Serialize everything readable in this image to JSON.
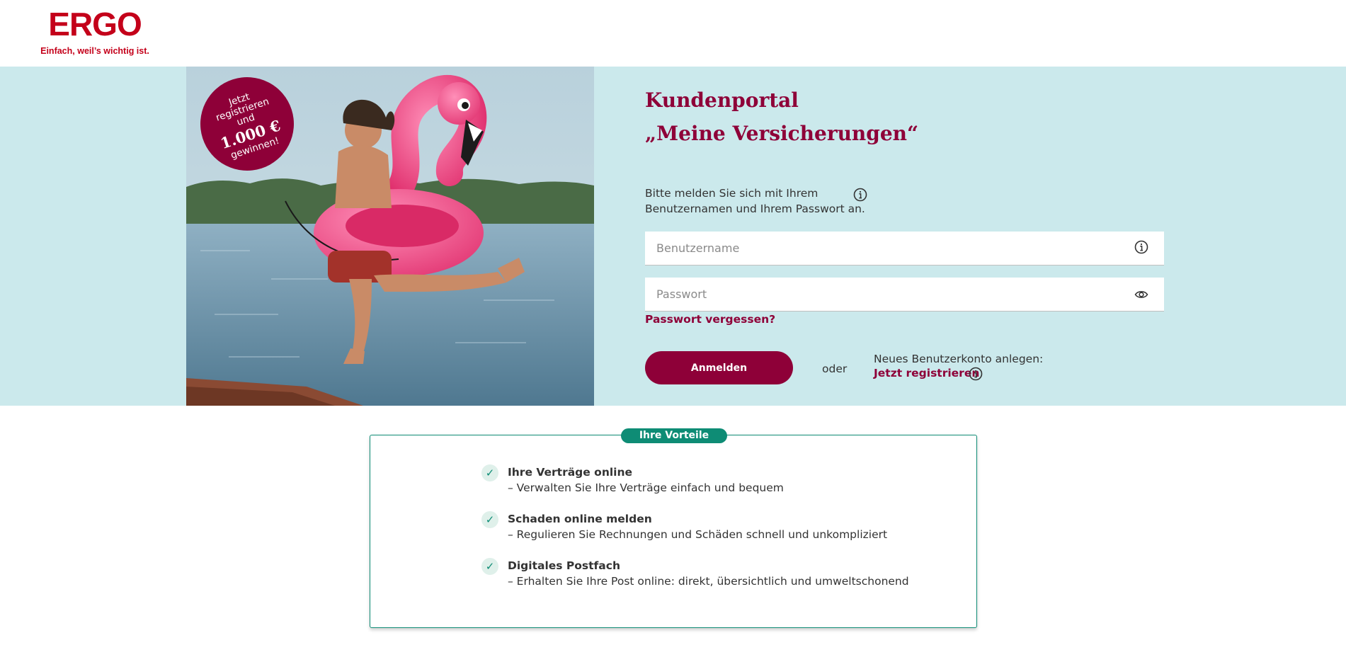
{
  "brand": {
    "logo_text": "ERGO",
    "claim": "Einfach, weil’s wichtig ist.",
    "color": "#c4001a"
  },
  "promo": {
    "line1": "Jetzt",
    "line2": "registrieren",
    "line3": "und",
    "amount": "1.000 €",
    "line4": "gewinnen!"
  },
  "login": {
    "title_line1": "Kundenportal",
    "title_line2": "„Meine Versicherungen“",
    "intro": "Bitte melden Sie sich mit Ihrem Benutzernamen und Ihrem Passwort an.",
    "username_placeholder": "Benutzername",
    "username_value": "",
    "password_placeholder": "Passwort",
    "password_value": "",
    "forgot_link": "Passwort vergessen?",
    "submit_label": "Anmelden",
    "or_label": "oder",
    "new_account_text": "Neues Benutzerkonto anlegen:",
    "register_link": "Jetzt registrieren"
  },
  "benefits": {
    "heading": "Ihre Vorteile",
    "items": [
      {
        "title": "Ihre Verträge online",
        "desc": "– Verwalten Sie Ihre Verträge einfach und bequem"
      },
      {
        "title": "Schaden online melden",
        "desc": "– Regulieren Sie Rechnungen und Schäden schnell und unkompliziert"
      },
      {
        "title": "Digitales Postfach",
        "desc": "– Erhalten Sie Ihre Post online: direkt, übersichtlich und umweltschonend"
      }
    ]
  },
  "icons": {
    "info": "info-circle-icon",
    "password_toggle": "eye-icon",
    "benefit_check": "check-icon"
  },
  "colors": {
    "accent": "#8e0038",
    "hero_background": "#cbe9ec",
    "benefit_green": "#0e8c75"
  }
}
